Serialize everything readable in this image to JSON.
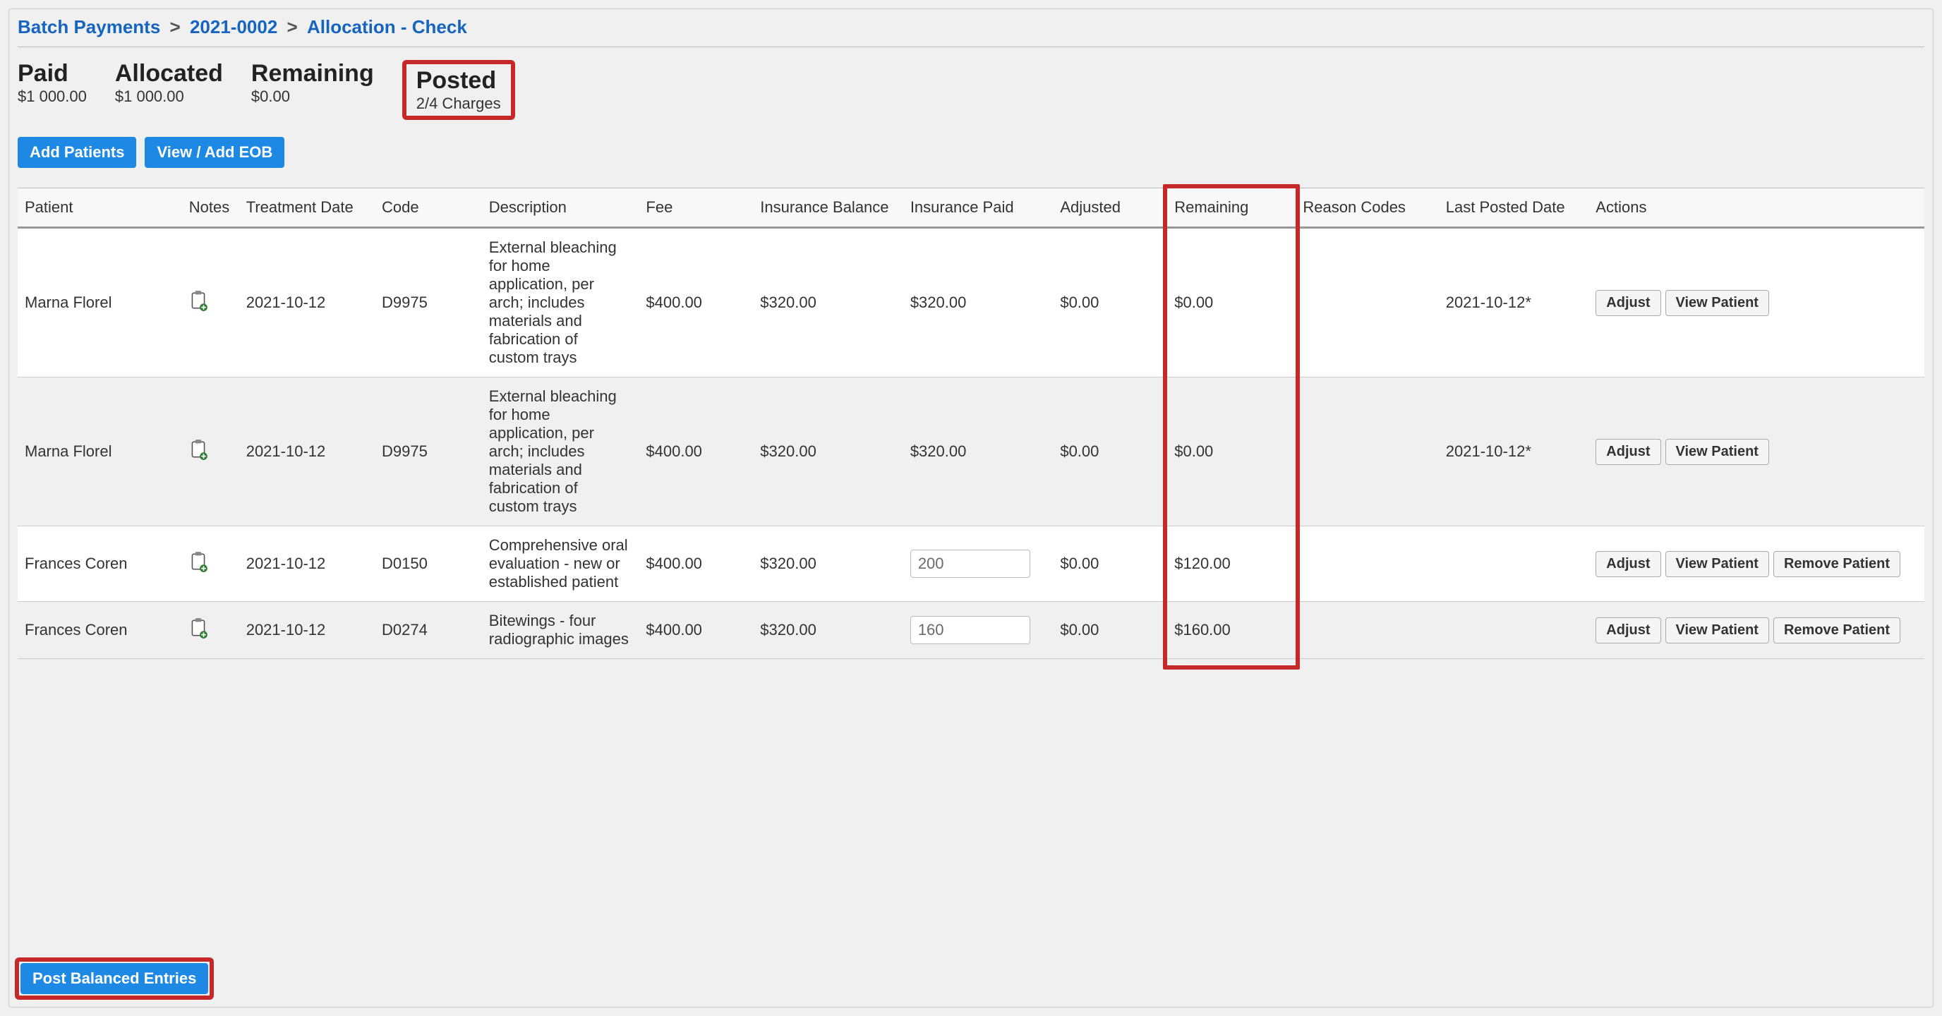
{
  "breadcrumb": {
    "root": "Batch Payments",
    "mid": "2021-0002",
    "current": "Allocation - Check"
  },
  "summary": {
    "paid": {
      "label": "Paid",
      "value": "$1 000.00"
    },
    "allocated": {
      "label": "Allocated",
      "value": "$1 000.00"
    },
    "remaining": {
      "label": "Remaining",
      "value": "$0.00"
    },
    "posted": {
      "label": "Posted",
      "value": "2/4 Charges"
    }
  },
  "buttons": {
    "add_patients": "Add Patients",
    "view_add_eob": "View / Add EOB",
    "post_balanced": "Post Balanced Entries",
    "adjust": "Adjust",
    "view_patient": "View Patient",
    "remove_patient": "Remove Patient"
  },
  "table": {
    "headers": {
      "patient": "Patient",
      "notes": "Notes",
      "treatment_date": "Treatment Date",
      "code": "Code",
      "description": "Description",
      "fee": "Fee",
      "insurance_balance": "Insurance Balance",
      "insurance_paid": "Insurance Paid",
      "adjusted": "Adjusted",
      "remaining": "Remaining",
      "reason_codes": "Reason Codes",
      "last_posted": "Last Posted Date",
      "actions": "Actions"
    },
    "rows": [
      {
        "patient": "Marna Florel",
        "treatment_date": "2021-10-12",
        "code": "D9975",
        "description": "External bleaching for home application, per arch; includes materials and fabrication of custom trays",
        "fee": "$400.00",
        "insurance_balance": "$320.00",
        "insurance_paid": "$320.00",
        "insurance_paid_editable": false,
        "adjusted": "$0.00",
        "remaining": "$0.00",
        "reason_codes": "",
        "last_posted": "2021-10-12*",
        "show_remove": false
      },
      {
        "patient": "Marna Florel",
        "treatment_date": "2021-10-12",
        "code": "D9975",
        "description": "External bleaching for home application, per arch; includes materials and fabrication of custom trays",
        "fee": "$400.00",
        "insurance_balance": "$320.00",
        "insurance_paid": "$320.00",
        "insurance_paid_editable": false,
        "adjusted": "$0.00",
        "remaining": "$0.00",
        "reason_codes": "",
        "last_posted": "2021-10-12*",
        "show_remove": false
      },
      {
        "patient": "Frances Coren",
        "treatment_date": "2021-10-12",
        "code": "D0150",
        "description": "Comprehensive oral evaluation - new or established patient",
        "fee": "$400.00",
        "insurance_balance": "$320.00",
        "insurance_paid": "200",
        "insurance_paid_editable": true,
        "adjusted": "$0.00",
        "remaining": "$120.00",
        "reason_codes": "",
        "last_posted": "",
        "show_remove": true
      },
      {
        "patient": "Frances Coren",
        "treatment_date": "2021-10-12",
        "code": "D0274",
        "description": "Bitewings - four radiographic images",
        "fee": "$400.00",
        "insurance_balance": "$320.00",
        "insurance_paid": "160",
        "insurance_paid_editable": true,
        "adjusted": "$0.00",
        "remaining": "$160.00",
        "reason_codes": "",
        "last_posted": "",
        "show_remove": true
      }
    ]
  },
  "highlights": {
    "posted_box": true,
    "remaining_column_box": true,
    "post_balanced_box": true
  }
}
